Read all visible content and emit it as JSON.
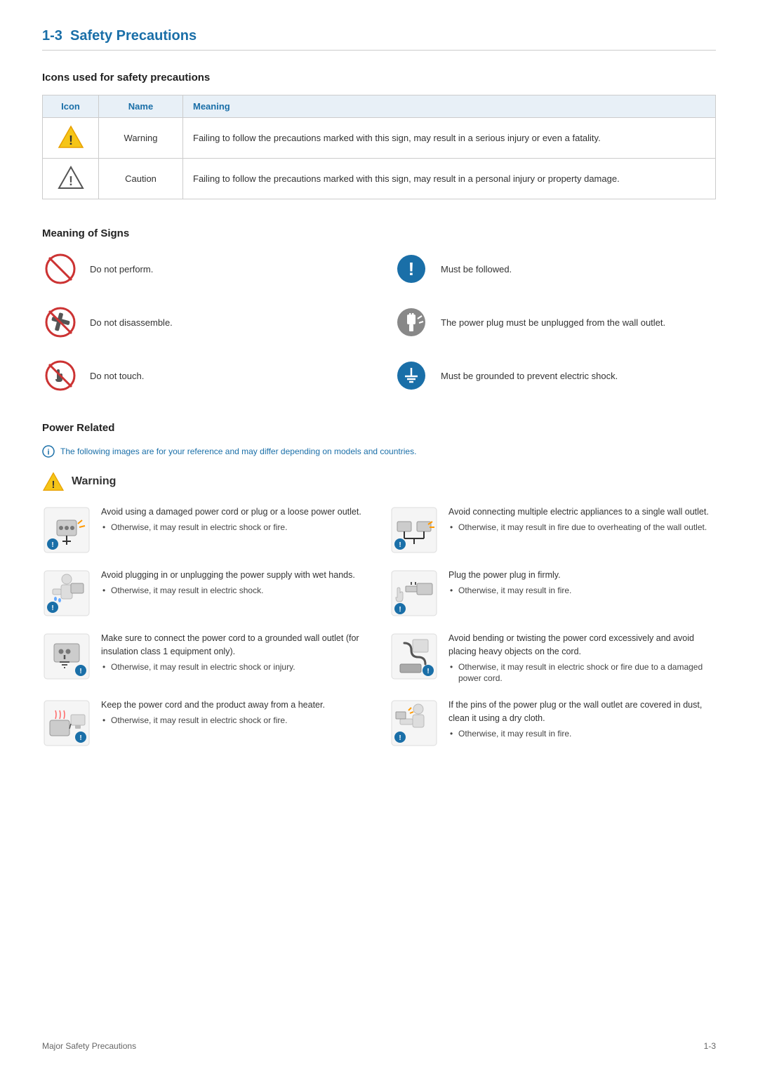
{
  "header": {
    "section_number": "1-3",
    "section_title": "Safety Precautions"
  },
  "icons_table": {
    "subsection_title": "Icons used for safety precautions",
    "columns": [
      "Icon",
      "Name",
      "Meaning"
    ],
    "rows": [
      {
        "name": "Warning",
        "meaning": "Failing to follow the precautions marked with this sign, may result in a serious injury or even a fatality."
      },
      {
        "name": "Caution",
        "meaning": "Failing to follow the precautions marked with this sign, may result in a personal injury or property damage."
      }
    ]
  },
  "meaning_of_signs": {
    "subsection_title": "Meaning of Signs",
    "signs": [
      {
        "id": "do-not-perform",
        "label": "Do not perform."
      },
      {
        "id": "must-be-followed",
        "label": "Must be followed."
      },
      {
        "id": "do-not-disassemble",
        "label": "Do not disassemble."
      },
      {
        "id": "power-unplug",
        "label": "The power plug must be unplugged from the wall outlet."
      },
      {
        "id": "do-not-touch",
        "label": "Do not touch."
      },
      {
        "id": "must-be-grounded",
        "label": "Must be grounded to prevent electric shock."
      }
    ]
  },
  "power_related": {
    "subsection_title": "Power Related",
    "note": "The following images are for your reference and may differ depending on models and countries.",
    "warning_label": "Warning",
    "items": [
      {
        "id": "damaged-cord",
        "main": "Avoid using a damaged power cord or plug or a loose power outlet.",
        "bullet": "Otherwise, it may result in electric shock or fire."
      },
      {
        "id": "multiple-appliances",
        "main": "Avoid connecting multiple electric appliances to a single wall outlet.",
        "bullet": "Otherwise, it may result in fire due to overheating of the wall outlet."
      },
      {
        "id": "wet-hands",
        "main": "Avoid plugging in or unplugging the power supply with wet hands.",
        "bullet": "Otherwise, it may result in electric shock."
      },
      {
        "id": "plug-firmly",
        "main": "Plug the power plug in firmly.",
        "bullet": "Otherwise, it may result in fire."
      },
      {
        "id": "grounded-outlet",
        "main": "Make sure to connect the power cord to a grounded wall outlet (for insulation class 1 equipment only).",
        "bullet": "Otherwise, it may result in electric shock or injury."
      },
      {
        "id": "bending-twisting",
        "main": "Avoid bending or twisting the power cord excessively and avoid placing heavy objects on the cord.",
        "bullet": "Otherwise, it may result in electric shock or fire due to a damaged power cord."
      },
      {
        "id": "away-from-heater",
        "main": "Keep the power cord and the product away from a heater.",
        "bullet": "Otherwise, it may result in electric shock or fire."
      },
      {
        "id": "dust-on-pins",
        "main": "If the pins of the power plug or the wall outlet are covered in dust, clean it using a dry cloth.",
        "bullet": "Otherwise, it may result in fire."
      }
    ]
  },
  "footer": {
    "left": "Major Safety Precautions",
    "right": "1-3"
  }
}
